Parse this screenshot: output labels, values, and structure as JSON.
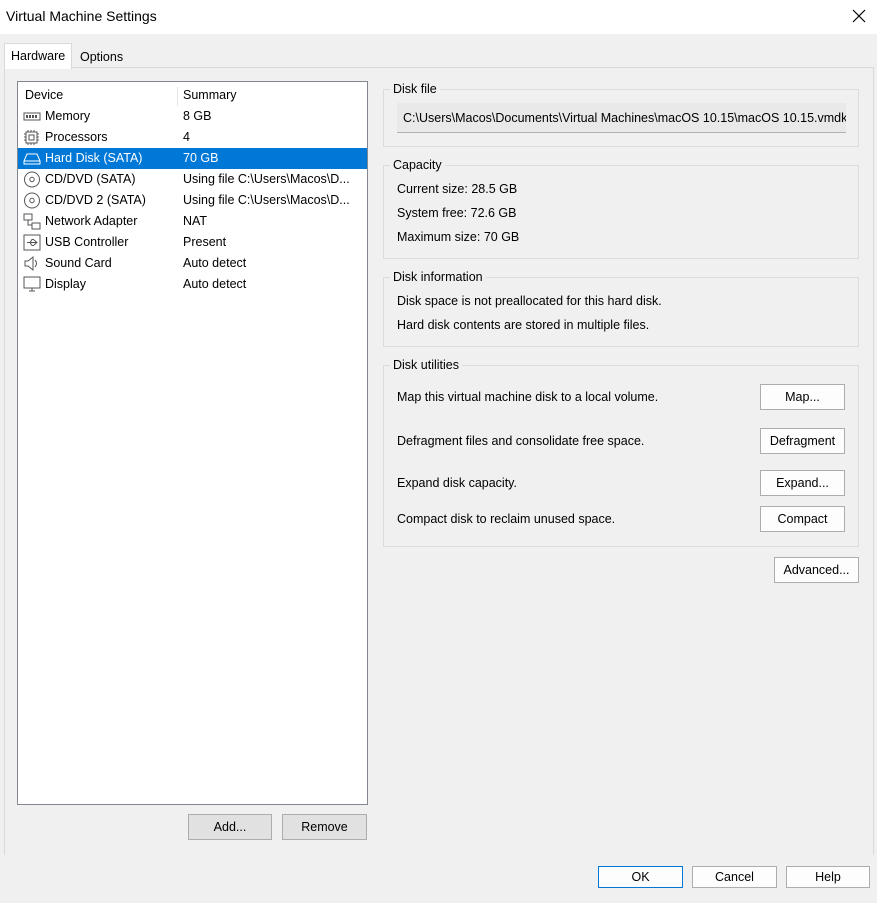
{
  "window": {
    "title": "Virtual Machine Settings"
  },
  "tabs": [
    {
      "label": "Hardware",
      "active": true
    },
    {
      "label": "Options",
      "active": false
    }
  ],
  "device_list": {
    "columns": [
      "Device",
      "Summary"
    ],
    "rows": [
      {
        "icon": "memory-icon",
        "device": "Memory",
        "summary": "8 GB"
      },
      {
        "icon": "processor-icon",
        "device": "Processors",
        "summary": "4"
      },
      {
        "icon": "hard-disk-icon",
        "device": "Hard Disk (SATA)",
        "summary": "70 GB",
        "selected": true
      },
      {
        "icon": "cd-dvd-icon",
        "device": "CD/DVD (SATA)",
        "summary": "Using file C:\\Users\\Macos\\D..."
      },
      {
        "icon": "cd-dvd-icon",
        "device": "CD/DVD 2 (SATA)",
        "summary": "Using file C:\\Users\\Macos\\D..."
      },
      {
        "icon": "network-adapter-icon",
        "device": "Network Adapter",
        "summary": "NAT"
      },
      {
        "icon": "usb-icon",
        "device": "USB Controller",
        "summary": "Present"
      },
      {
        "icon": "sound-icon",
        "device": "Sound Card",
        "summary": "Auto detect"
      },
      {
        "icon": "display-icon",
        "device": "Display",
        "summary": "Auto detect"
      }
    ],
    "add_label": "Add...",
    "remove_label": "Remove"
  },
  "disk_file": {
    "label": "Disk file",
    "path": "C:\\Users\\Macos\\Documents\\Virtual Machines\\macOS 10.15\\macOS 10.15.vmdk"
  },
  "capacity": {
    "label": "Capacity",
    "current": "Current size:  28.5 GB",
    "system_free": "System free:  72.6 GB",
    "maximum": "Maximum size:  70 GB"
  },
  "disk_information": {
    "label": "Disk information",
    "line1": "Disk space is not preallocated for this hard disk.",
    "line2": "Hard disk contents are stored in multiple files."
  },
  "disk_utilities": {
    "label": "Disk utilities",
    "items": [
      {
        "text": "Map this virtual machine disk to a local volume.",
        "button": "Map..."
      },
      {
        "text": "Defragment files and consolidate free space.",
        "button": "Defragment"
      },
      {
        "text": "Expand disk capacity.",
        "button": "Expand..."
      },
      {
        "text": "Compact disk to reclaim unused space.",
        "button": "Compact"
      }
    ]
  },
  "advanced_label": "Advanced...",
  "footer": {
    "ok": "OK",
    "cancel": "Cancel",
    "help": "Help"
  },
  "colors": {
    "selection": "#0078d7",
    "background": "#f0f0f0"
  }
}
